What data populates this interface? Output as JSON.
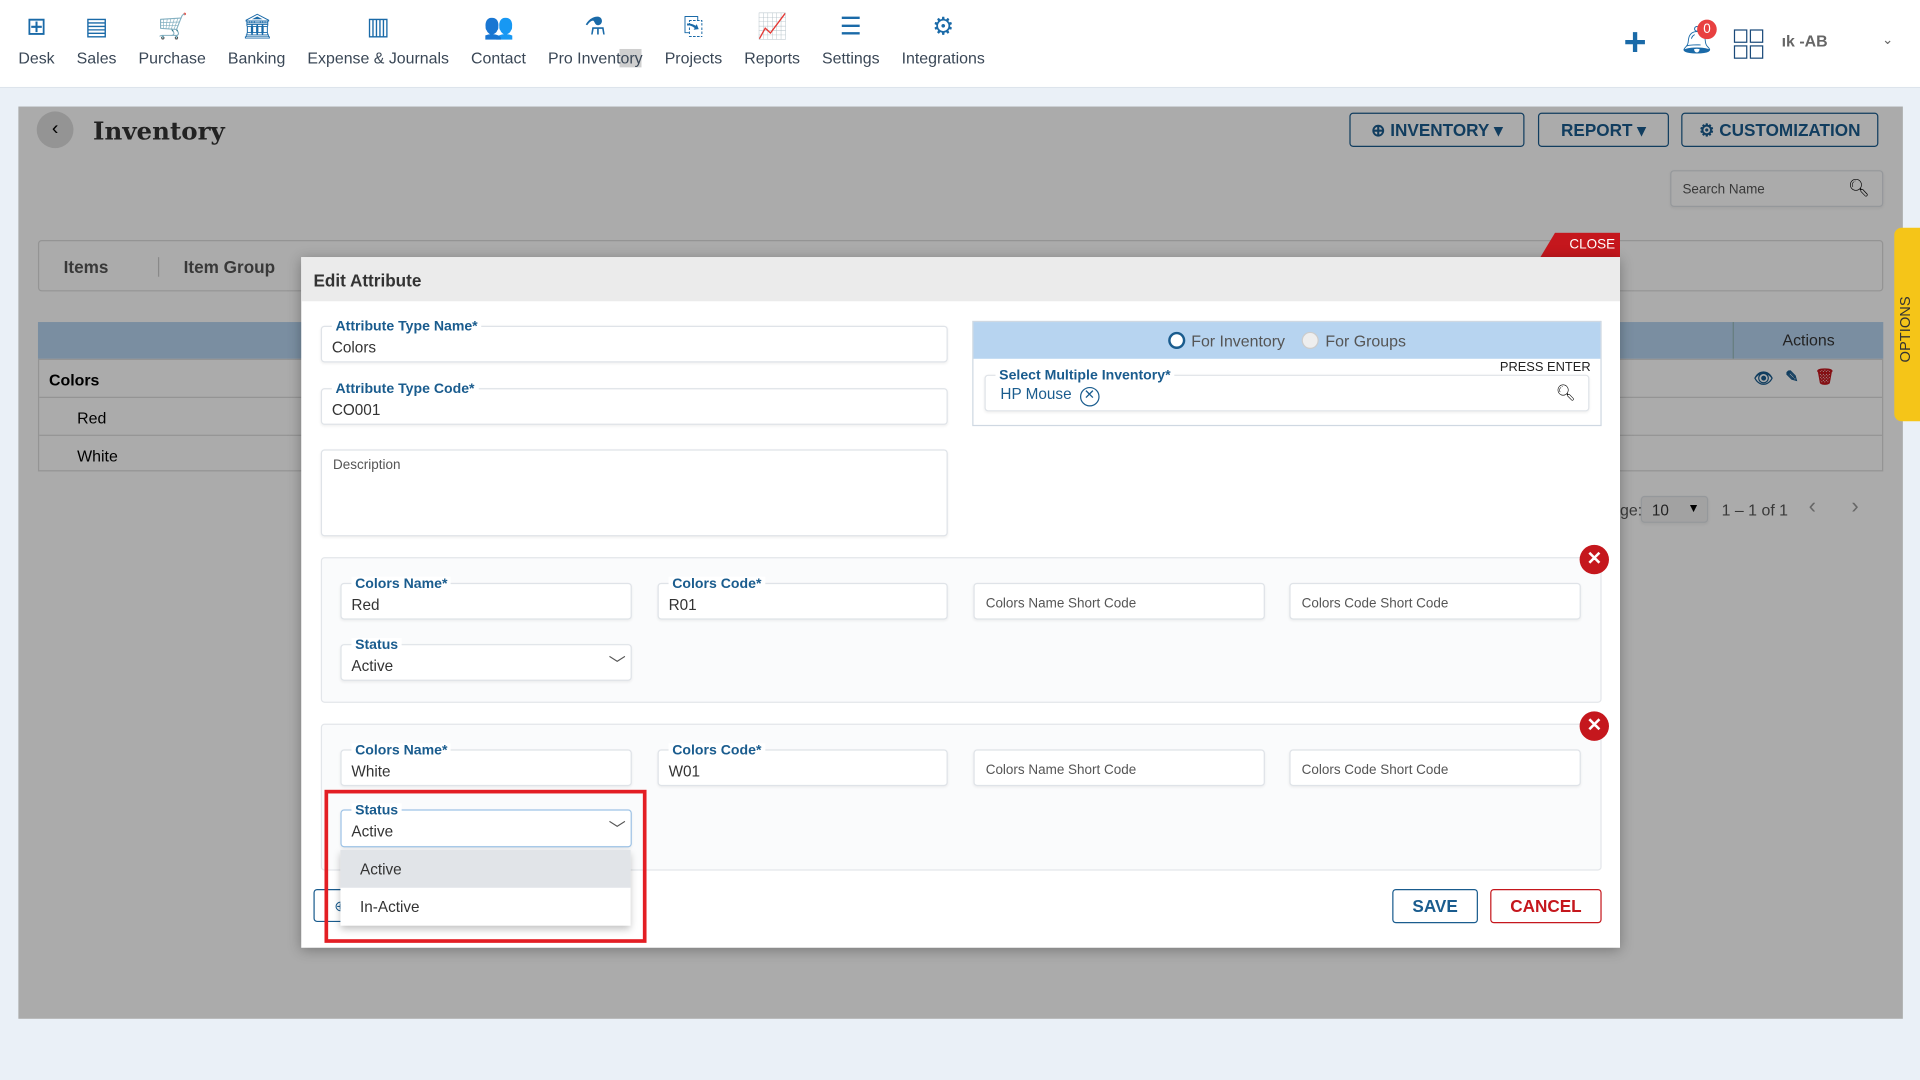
{
  "nav": [
    {
      "label": "Desk",
      "icon": "desk-icon",
      "glyph": "⊞"
    },
    {
      "label": "Sales",
      "icon": "sales-icon",
      "glyph": "▤"
    },
    {
      "label": "Purchase",
      "icon": "cart-icon",
      "glyph": "🛒"
    },
    {
      "label": "Banking",
      "icon": "bank-icon",
      "glyph": "🏛"
    },
    {
      "label": "Expense & Journals",
      "icon": "journal-icon",
      "glyph": "▥"
    },
    {
      "label": "Contact",
      "icon": "contact-icon",
      "glyph": "👥"
    },
    {
      "label": "Pro Inventory",
      "icon": "inventory-icon",
      "glyph": "⚗"
    },
    {
      "label": "Projects",
      "icon": "projects-icon",
      "glyph": "⎘"
    },
    {
      "label": "Reports",
      "icon": "reports-icon",
      "glyph": "📈"
    },
    {
      "label": "Settings",
      "icon": "sliders-icon",
      "glyph": "☰"
    },
    {
      "label": "Integrations",
      "icon": "integrations-icon",
      "glyph": "⚙"
    }
  ],
  "header": {
    "notifications": "0",
    "user": "ık -AB"
  },
  "page": {
    "title": "Inventory",
    "inventory_btn": "INVENTORY",
    "report_btn": "REPORT",
    "customization_btn": "CUSTOMIZATION",
    "search_placeholder": "Search Name",
    "options_tab": "OPTIONS"
  },
  "tabs": [
    "Items",
    "Item Group"
  ],
  "table": {
    "actions_header": "Actions",
    "group": "Colors",
    "rows": [
      "Red",
      "White"
    ],
    "per_page": "10",
    "range": "1 – 1 of 1",
    "per_page_label": "ge:"
  },
  "modal": {
    "close": "CLOSE",
    "title": "Edit Attribute",
    "type_name_label": "Attribute Type Name",
    "type_name": "Colors",
    "type_code_label": "Attribute Type Code",
    "type_code": "CO001",
    "description_label": "Description",
    "radio_inventory": "For Inventory",
    "radio_groups": "For Groups",
    "select_label": "Select Multiple Inventory",
    "press_enter": "PRESS ENTER",
    "chip": "HP Mouse",
    "rows": [
      {
        "name_label": "Colors Name",
        "name": "Red",
        "code_label": "Colors Code",
        "code": "R01",
        "name_short_ph": "Colors Name Short Code",
        "code_short_ph": "Colors Code Short Code",
        "status_label": "Status",
        "status": "Active"
      },
      {
        "name_label": "Colors Name",
        "name": "White",
        "code_label": "Colors Code",
        "code": "W01",
        "name_short_ph": "Colors Name Short Code",
        "code_short_ph": "Colors Code Short Code",
        "status_label": "Status",
        "status": "Active"
      }
    ],
    "options": [
      "Active",
      "In-Active"
    ],
    "save": "SAVE",
    "cancel": "CANCEL"
  },
  "colors": {
    "brand": "#1a5c8e",
    "danger": "#c5171d",
    "highlight": "#e31e24",
    "options_tab": "#f5c518"
  }
}
